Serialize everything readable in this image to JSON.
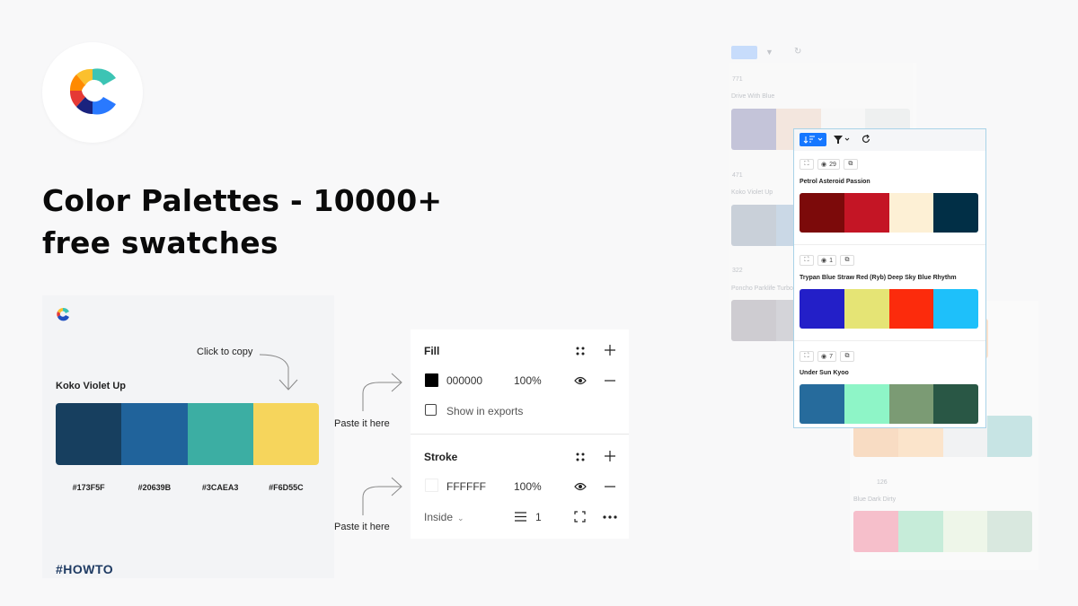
{
  "headline": "Color Palettes - 10000+ free swatches",
  "howto": {
    "click_to_copy": "Click to copy",
    "palette_name": "Koko Violet Up",
    "swatches": [
      "#173F5F",
      "#20639B",
      "#3CAEA3",
      "#F6D55C"
    ],
    "codes": [
      "#173F5F",
      "#20639B",
      "#3CAEA3",
      "#F6D55C"
    ],
    "tag": "#HOWTO"
  },
  "paste_labels": [
    "Paste it here",
    "Paste it here"
  ],
  "design_panel": {
    "fill": {
      "title": "Fill",
      "hex": "000000",
      "opacity": "100%",
      "show_in_exports": "Show in exports"
    },
    "stroke": {
      "title": "Stroke",
      "hex": "FFFFFF",
      "opacity": "100%",
      "position": "Inside",
      "weight": "1"
    }
  },
  "background_list": [
    {
      "views": "771",
      "name": "Drive With Blue",
      "colors": [
        "#c2c2d8",
        "#f3e6dd",
        "#f7f7f7",
        "#eef0f0"
      ]
    },
    {
      "views": "471",
      "name": "Koko Violet Up",
      "colors": [
        "#c7ced8",
        "#c8d7e6",
        "#cfe0ec",
        "#d3e0ea"
      ]
    },
    {
      "views": "322",
      "name": "Poncho Parklife Turbos",
      "colors": [
        "#cccacf",
        "#d3d3d8",
        "#dcdcdf",
        "#e2e2e4"
      ]
    }
  ],
  "background_list_2": [
    {
      "name": "",
      "colors": [
        "#f8dcc3",
        "#fbe4cb",
        "#f1f2f3",
        "#c7e4e4"
      ]
    },
    {
      "views": "126",
      "name": "Blue Dark Dirty",
      "colors": [
        "#f6bfcb",
        "#c6ecd9",
        "#eef6e9",
        "#d9e8df"
      ]
    }
  ],
  "front_list": {
    "palettes": [
      {
        "views": "29",
        "name": "Petrol Asteroid Passion",
        "colors": [
          "#7c0a0a",
          "#c41525",
          "#fdf0d5",
          "#012f46"
        ]
      },
      {
        "views": "1",
        "name": "Trypan Blue Straw Red (Ryb) Deep Sky Blue Rhythm",
        "colors": [
          "#231fc8",
          "#e5e475",
          "#fc2b0c",
          "#1ec0fa"
        ]
      },
      {
        "views": "7",
        "name": "Under Sun Kyoo",
        "colors": [
          "#266b9c",
          "#8ef5c7",
          "#7b9b74",
          "#295745"
        ]
      }
    ]
  },
  "colors": {
    "accent": "#1677ff",
    "headline": "#0a0a0a",
    "howto_tag": "#1f3b63"
  }
}
